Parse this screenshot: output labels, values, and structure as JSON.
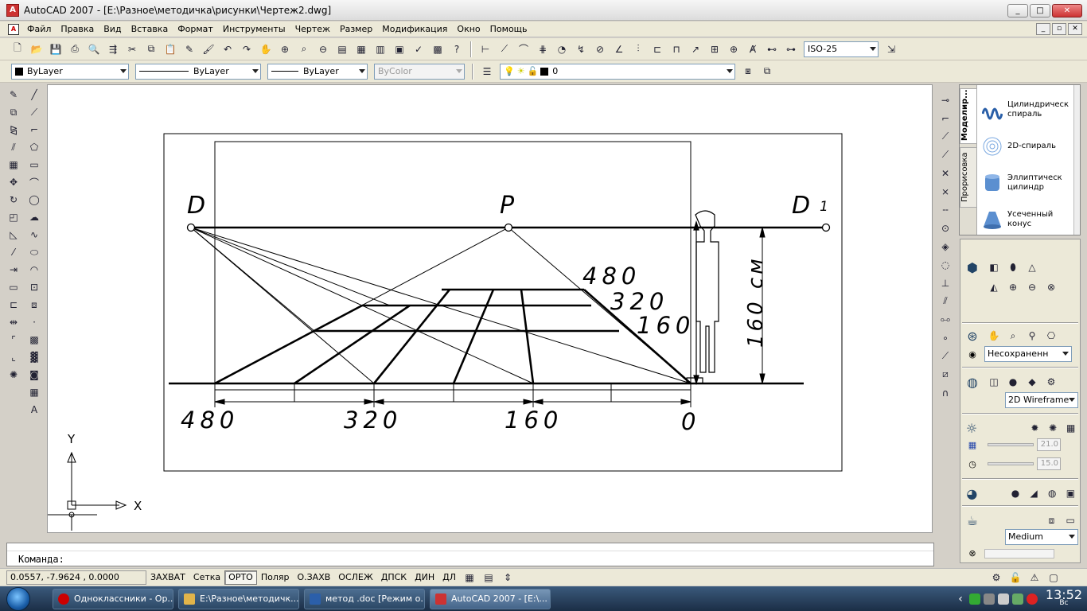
{
  "window": {
    "title": "AutoCAD 2007 - [E:\\Разное\\методичка\\рисунки\\Чертеж2.dwg]",
    "app_icon": "autocad-icon",
    "controls": [
      "_",
      "□",
      "✕"
    ]
  },
  "menu": [
    "Файл",
    "Правка",
    "Вид",
    "Вставка",
    "Формат",
    "Инструменты",
    "Чертеж",
    "Размер",
    "Модификация",
    "Окно",
    "Помощь"
  ],
  "mdi_controls": [
    "_",
    "▫",
    "✕"
  ],
  "toolbar1": {
    "icons": [
      "new-icon",
      "open-icon",
      "save-icon",
      "plot-icon",
      "preview-icon",
      "publish-icon",
      "cut-icon",
      "copy-icon",
      "paste-icon",
      "match-icon",
      "brush-icon",
      "undo-icon",
      "redo-icon",
      "pan-icon",
      "zoom-realtime-icon",
      "zoom-window-icon",
      "zoom-previous-icon",
      "properties-icon",
      "designcenter-icon",
      "toolpalettes-icon",
      "sheetset-icon",
      "markup-icon",
      "calculator-icon",
      "help-icon"
    ],
    "dim_icons": [
      "dim-linear-icon",
      "dim-aligned-icon",
      "dim-arc-icon",
      "dim-ordinate-icon",
      "dim-radius-icon",
      "dim-jogged-icon",
      "dim-diameter-icon",
      "dim-angular-icon",
      "quick-dim-icon",
      "dim-baseline-icon",
      "dim-continue-icon",
      "quick-leader-icon",
      "tolerance-icon",
      "center-mark-icon",
      "dim-edit-icon",
      "dim-text-edit-icon",
      "dim-update-icon"
    ],
    "dimstyle": "ISO-25"
  },
  "toolbar2": {
    "color": "ByLayer",
    "linetype": "ByLayer",
    "lineweight": "ByLayer",
    "plotstyle": "ByColor",
    "layer": "0"
  },
  "draw_tools": [
    "line-icon",
    "construction-line-icon",
    "polyline-icon",
    "polygon-icon",
    "rectangle-icon",
    "arc-icon",
    "circle-icon",
    "revcloud-icon",
    "spline-icon",
    "ellipse-icon",
    "ellipse-arc-icon",
    "insert-block-icon",
    "make-block-icon",
    "point-icon",
    "hatch-icon",
    "gradient-icon",
    "region-icon",
    "table-icon",
    "mtext-icon"
  ],
  "modify_tools": [
    "erase-icon",
    "copy-object-icon",
    "mirror-icon",
    "offset-icon",
    "array-icon",
    "move-icon",
    "rotate-icon",
    "scale-icon",
    "stretch-icon",
    "trim-icon",
    "extend-icon",
    "break-point-icon",
    "break-icon",
    "join-icon",
    "chamfer-icon",
    "fillet-icon",
    "explode-icon"
  ],
  "snap_tools": [
    "snap-endpoint-icon",
    "snap-midpoint-icon",
    "snap-intersection-icon",
    "snap-apparent-icon",
    "snap-extension-icon",
    "snap-center-icon",
    "snap-quadrant-icon",
    "snap-tangent-icon",
    "snap-perpendicular-icon",
    "snap-parallel-icon",
    "snap-insert-icon",
    "snap-node-icon",
    "snap-nearest-icon",
    "snap-none-icon",
    "osnap-settings-icon"
  ],
  "tool_palette": {
    "tabs": [
      "Моделир...",
      "Прорисовка"
    ],
    "items": [
      {
        "label": "Цилиндрическ спираль",
        "icon": "helix-icon"
      },
      {
        "label": "2D-спираль",
        "icon": "spiral-icon"
      },
      {
        "label": "Эллиптическ цилиндр",
        "icon": "elliptic-cylinder-icon"
      },
      {
        "label": "Усеченный конус",
        "icon": "frustum-cone-icon"
      }
    ]
  },
  "dashboard": {
    "view_select": "Несохраненн",
    "visual_style": "2D Wireframe",
    "light_values": [
      "21.0",
      "15.0"
    ],
    "render_quality": "Medium"
  },
  "drawing": {
    "labels": {
      "D": "D",
      "P": "P",
      "D1": "D",
      "D1_sub": "1",
      "h480": "480",
      "h320": "320",
      "h160": "160",
      "b480": "480",
      "b320": "320",
      "b160": "160",
      "b0": "0",
      "height": "160 см"
    },
    "ucs": {
      "x": "X",
      "y": "Y"
    }
  },
  "command": {
    "prompt": "Команда:"
  },
  "status": {
    "coords": "0.0557,  -7.9624 , 0.0000",
    "buttons": [
      {
        "label": "ЗАХВАТ",
        "on": false
      },
      {
        "label": "Сетка",
        "on": false
      },
      {
        "label": "ОРТО",
        "on": true
      },
      {
        "label": "Поляр",
        "on": false
      },
      {
        "label": "О.ЗАХВ",
        "on": false
      },
      {
        "label": "ОСЛЕЖ",
        "on": false
      },
      {
        "label": "ДПСК",
        "on": false
      },
      {
        "label": "ДИН",
        "on": false
      },
      {
        "label": "ДЛ",
        "on": false
      }
    ]
  },
  "taskbar": {
    "tasks": [
      {
        "label": "Одноклассники - Op...",
        "icon": "opera-icon",
        "color": "#c00"
      },
      {
        "label": "E:\\Разное\\методичк...",
        "icon": "folder-icon",
        "color": "#e2b44a"
      },
      {
        "label": "метод .doc [Режим о...",
        "icon": "word-icon",
        "color": "#2b5faa"
      },
      {
        "label": "AutoCAD 2007 - [E:\\...",
        "icon": "autocad-task-icon",
        "color": "#c33"
      }
    ],
    "clock": {
      "time": "13:52",
      "day": "Вс"
    }
  }
}
